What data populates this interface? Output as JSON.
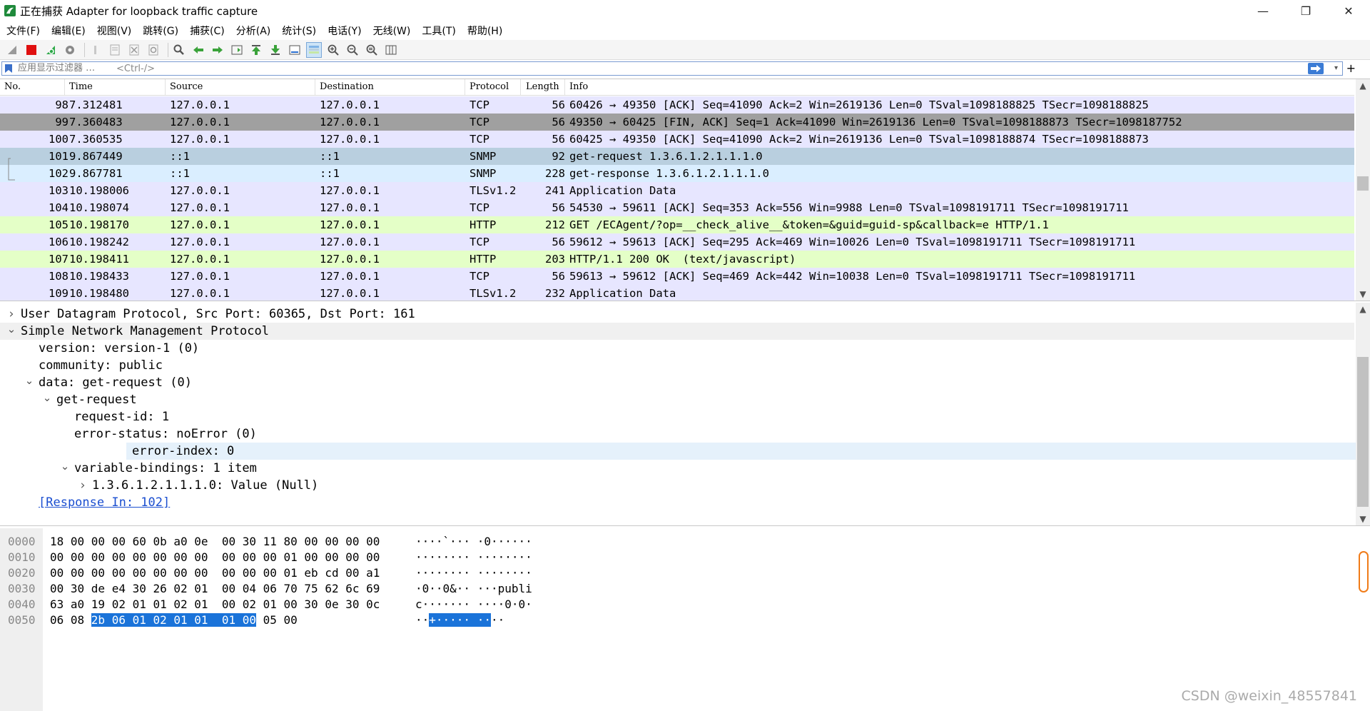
{
  "window": {
    "title": "正在捕获 Adapter for loopback traffic capture",
    "minimize_glyph": "—",
    "restore_glyph": "❐",
    "close_glyph": "✕"
  },
  "menu": [
    "文件(F)",
    "编辑(E)",
    "视图(V)",
    "跳转(G)",
    "捕获(C)",
    "分析(A)",
    "统计(S)",
    "电话(Y)",
    "无线(W)",
    "工具(T)",
    "帮助(H)"
  ],
  "filter": {
    "label": "应用显示过滤器 …",
    "placeholder": "<Ctrl-/>",
    "value": ""
  },
  "packet_list": {
    "columns": [
      "No.",
      "Time",
      "Source",
      "Destination",
      "Protocol",
      "Length",
      "Info"
    ],
    "rows": [
      {
        "no": "98",
        "time": "7.312481",
        "src": "127.0.0.1",
        "dst": "127.0.0.1",
        "proto": "TCP",
        "len": "56",
        "info": "60426 → 49350 [ACK] Seq=41090 Ack=2 Win=2619136 Len=0 TSval=1098188825 TSecr=1098188825",
        "bg": "#e7e6ff"
      },
      {
        "no": "99",
        "time": "7.360483",
        "src": "127.0.0.1",
        "dst": "127.0.0.1",
        "proto": "TCP",
        "len": "56",
        "info": "49350 → 60425 [FIN, ACK] Seq=1 Ack=41090 Win=2619136 Len=0 TSval=1098188873 TSecr=1098187752",
        "bg": "#a0a0a0"
      },
      {
        "no": "100",
        "time": "7.360535",
        "src": "127.0.0.1",
        "dst": "127.0.0.1",
        "proto": "TCP",
        "len": "56",
        "info": "60425 → 49350 [ACK] Seq=41090 Ack=2 Win=2619136 Len=0 TSval=1098188874 TSecr=1098188873",
        "bg": "#e7e6ff"
      },
      {
        "no": "101",
        "time": "9.867449",
        "src": "::1",
        "dst": "::1",
        "proto": "SNMP",
        "len": "92",
        "info": "get-request 1.3.6.1.2.1.1.1.0",
        "bg": "#b9cfdf"
      },
      {
        "no": "102",
        "time": "9.867781",
        "src": "::1",
        "dst": "::1",
        "proto": "SNMP",
        "len": "228",
        "info": "get-response 1.3.6.1.2.1.1.1.0",
        "bg": "#daeeff"
      },
      {
        "no": "103",
        "time": "10.198006",
        "src": "127.0.0.1",
        "dst": "127.0.0.1",
        "proto": "TLSv1.2",
        "len": "241",
        "info": "Application Data",
        "bg": "#e7e6ff"
      },
      {
        "no": "104",
        "time": "10.198074",
        "src": "127.0.0.1",
        "dst": "127.0.0.1",
        "proto": "TCP",
        "len": "56",
        "info": "54530 → 59611 [ACK] Seq=353 Ack=556 Win=9988 Len=0 TSval=1098191711 TSecr=1098191711",
        "bg": "#e7e6ff"
      },
      {
        "no": "105",
        "time": "10.198170",
        "src": "127.0.0.1",
        "dst": "127.0.0.1",
        "proto": "HTTP",
        "len": "212",
        "info": "GET /ECAgent/?op=__check_alive__&token=&guid=guid-sp&callback=e HTTP/1.1",
        "bg": "#e4ffc7"
      },
      {
        "no": "106",
        "time": "10.198242",
        "src": "127.0.0.1",
        "dst": "127.0.0.1",
        "proto": "TCP",
        "len": "56",
        "info": "59612 → 59613 [ACK] Seq=295 Ack=469 Win=10026 Len=0 TSval=1098191711 TSecr=1098191711",
        "bg": "#e7e6ff"
      },
      {
        "no": "107",
        "time": "10.198411",
        "src": "127.0.0.1",
        "dst": "127.0.0.1",
        "proto": "HTTP",
        "len": "203",
        "info": "HTTP/1.1 200 OK  (text/javascript)",
        "bg": "#e4ffc7"
      },
      {
        "no": "108",
        "time": "10.198433",
        "src": "127.0.0.1",
        "dst": "127.0.0.1",
        "proto": "TCP",
        "len": "56",
        "info": "59613 → 59612 [ACK] Seq=469 Ack=442 Win=10038 Len=0 TSval=1098191711 TSecr=1098191711",
        "bg": "#e7e6ff"
      },
      {
        "no": "109",
        "time": "10.198480",
        "src": "127.0.0.1",
        "dst": "127.0.0.1",
        "proto": "TLSv1.2",
        "len": "232",
        "info": "Application Data",
        "bg": "#e7e6ff"
      }
    ]
  },
  "details": [
    {
      "level": 0,
      "exp": ">",
      "text": "User Datagram Protocol, Src Port: 60365, Dst Port: 161",
      "bg": "#ffffff"
    },
    {
      "level": 0,
      "exp": "v",
      "text": "Simple Network Management Protocol",
      "bg": "#f0f0f0"
    },
    {
      "level": 1,
      "exp": "",
      "text": "version: version-1 (0)",
      "bg": "#ffffff"
    },
    {
      "level": 1,
      "exp": "",
      "text": "community: public",
      "bg": "#ffffff"
    },
    {
      "level": 1,
      "exp": "v",
      "text": "data: get-request (0)",
      "bg": "#ffffff"
    },
    {
      "level": 2,
      "exp": "v",
      "text": "get-request",
      "bg": "#ffffff"
    },
    {
      "level": 3,
      "exp": "",
      "text": "request-id: 1",
      "bg": "#ffffff"
    },
    {
      "level": 3,
      "exp": "",
      "text": "error-status: noError (0)",
      "bg": "#ffffff"
    },
    {
      "level": 3,
      "exp": "",
      "text": "error-index: 0",
      "bg": "#e5f1fb"
    },
    {
      "level": 3,
      "exp": "v",
      "text": "variable-bindings: 1 item",
      "bg": "#ffffff"
    },
    {
      "level": 4,
      "exp": ">",
      "text": "1.3.6.1.2.1.1.1.0: Value (Null)",
      "bg": "#ffffff"
    },
    {
      "level": 1,
      "exp": "",
      "text": "[Response In: 102]",
      "bg": "#ffffff",
      "link": true
    }
  ],
  "bytes": [
    {
      "off": "0000",
      "hex": "18 00 00 00 60 0b a0 0e  00 30 11 80 00 00 00 00",
      "ascii": "····`··· ·0······"
    },
    {
      "off": "0010",
      "hex": "00 00 00 00 00 00 00 00  00 00 00 01 00 00 00 00",
      "ascii": "········ ········"
    },
    {
      "off": "0020",
      "hex": "00 00 00 00 00 00 00 00  00 00 00 01 eb cd 00 a1",
      "ascii": "········ ········"
    },
    {
      "off": "0030",
      "hex": "00 30 de e4 30 26 02 01  00 04 06 70 75 62 6c 69",
      "ascii": "·0··0&·· ···publi"
    },
    {
      "off": "0040",
      "hex": "63 a0 19 02 01 01 02 01  00 02 01 00 30 0e 30 0c",
      "ascii": "c······· ····0·0·"
    },
    {
      "off": "0050",
      "hex_pre": "06 08 ",
      "hex_hl": "2b 06 01 02 01 01  01 00",
      "hex_post": " 05 00",
      "ascii_pre": "··",
      "ascii_hl": "+····· ··",
      "ascii_post": "··"
    }
  ],
  "watermark": "CSDN @weixin_48557841",
  "icons": [
    "shark-fin-icon",
    "stop-icon",
    "restart-icon",
    "options-icon",
    "open-icon",
    "save-icon",
    "close-file-icon",
    "reload-icon",
    "find-icon",
    "back-icon",
    "forward-icon",
    "goto-icon",
    "first-icon",
    "last-icon",
    "autoscroll-icon",
    "colorize-icon",
    "zoom-in-icon",
    "zoom-out-icon",
    "zoom-normal-icon",
    "resize-columns-icon"
  ]
}
